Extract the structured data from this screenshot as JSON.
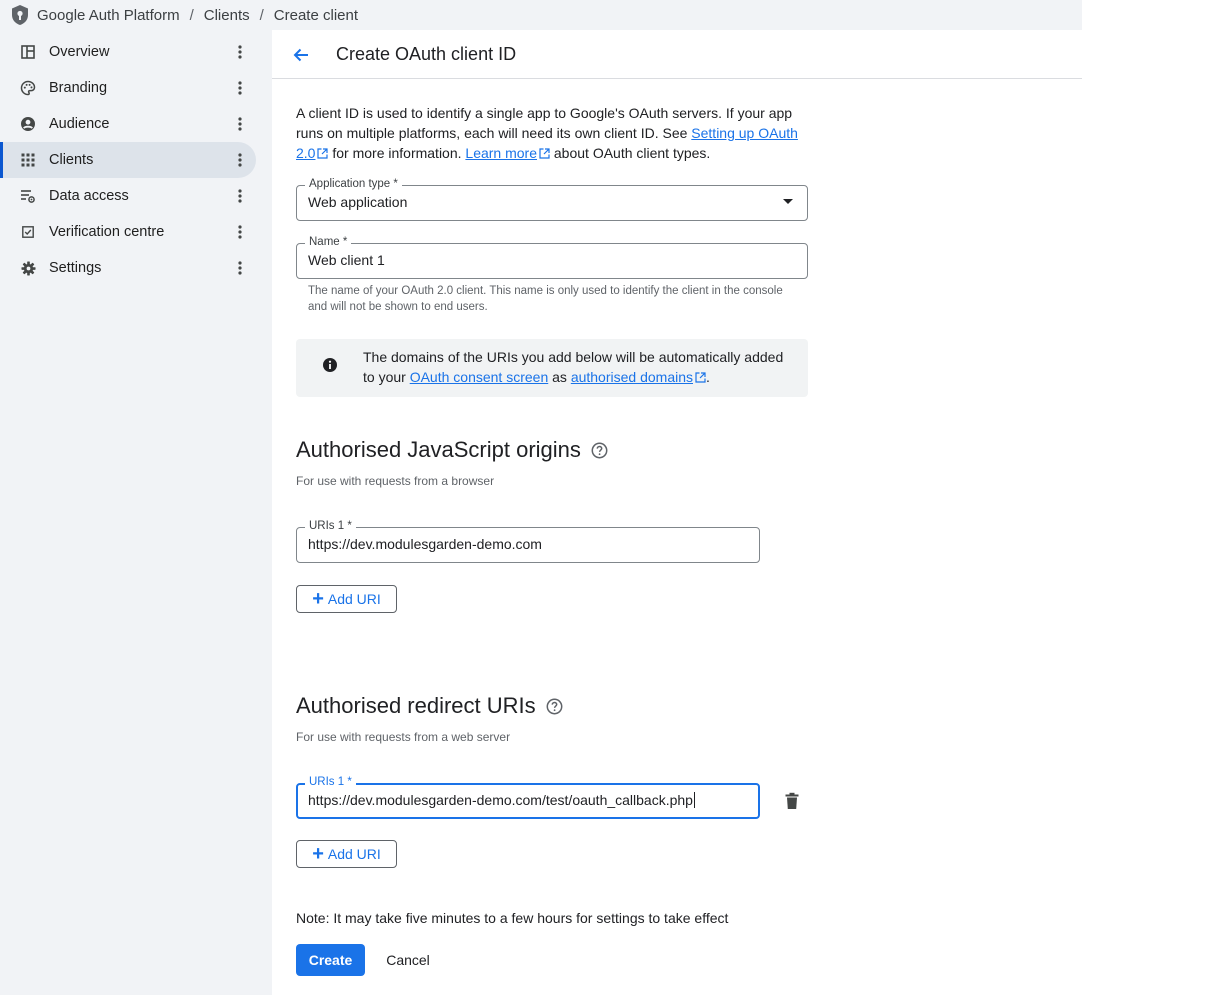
{
  "breadcrumb": {
    "logo_icon": "shield-icon",
    "items": [
      "Google Auth Platform",
      "Clients",
      "Create client"
    ],
    "separator": "/"
  },
  "sidebar": {
    "items": [
      {
        "label": "Overview",
        "icon": "dashboard-icon"
      },
      {
        "label": "Branding",
        "icon": "palette-icon"
      },
      {
        "label": "Audience",
        "icon": "account-circle-icon"
      },
      {
        "label": "Clients",
        "icon": "apps-grid-icon",
        "active": true
      },
      {
        "label": "Data access",
        "icon": "data-settings-icon"
      },
      {
        "label": "Verification centre",
        "icon": "verified-checkbox-icon"
      },
      {
        "label": "Settings",
        "icon": "gear-icon"
      }
    ]
  },
  "header": {
    "title": "Create OAuth client ID"
  },
  "intro": {
    "text1": "A client ID is used to identify a single app to Google's OAuth servers. If your app runs on multiple platforms, each will need its own client ID. See ",
    "link1": "Setting up OAuth 2.0",
    "text2": " for more information. ",
    "link2": "Learn more",
    "text3": " about OAuth client types."
  },
  "app_type": {
    "label": "Application type *",
    "value": "Web application"
  },
  "name_field": {
    "label": "Name *",
    "value": "Web client 1",
    "hint": "The name of your OAuth 2.0 client. This name is only used to identify the client in the console and will not be shown to end users."
  },
  "info": {
    "text1": "The domains of the URIs you add below will be automatically added to your ",
    "link1": "OAuth consent screen",
    "text2": " as ",
    "link2": "authorised domains",
    "text3": "."
  },
  "js_origins": {
    "title": "Authorised JavaScript origins",
    "subtitle": "For use with requests from a browser",
    "uri_label": "URIs 1 *",
    "uri_value": "https://dev.modulesgarden-demo.com",
    "add_label": "Add URI"
  },
  "redirect_uris": {
    "title": "Authorised redirect URIs",
    "subtitle": "For use with requests from a web server",
    "uri_label": "URIs 1 *",
    "uri_value": "https://dev.modulesgarden-demo.com/test/oauth_callback.php",
    "add_label": "Add URI"
  },
  "footer": {
    "note": "Note: It may take five minutes to a few hours for settings to take effect",
    "create_label": "Create",
    "cancel_label": "Cancel"
  },
  "colors": {
    "accent": "#1a73e8",
    "sidebar_bg": "#f1f3f6",
    "active_bg": "#dde3ea"
  }
}
